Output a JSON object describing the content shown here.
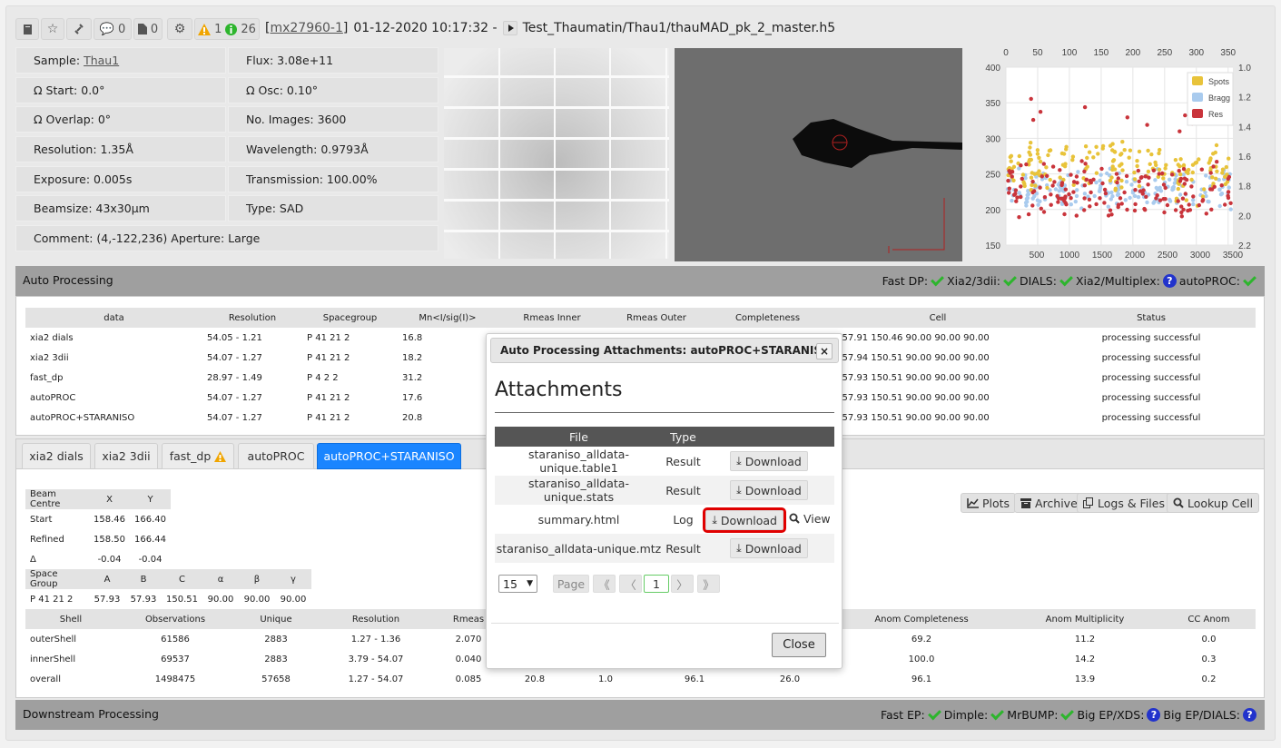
{
  "header": {
    "comments_count": "0",
    "files_count": "0",
    "warning_count": "1",
    "info_count": "26",
    "session_link": "mx27960-1",
    "bracket_open": "[",
    "bracket_close": "]",
    "datetime": "01-12-2020 10:17:32 -",
    "path": "Test_Thaumatin/Thau1/thauMAD_pk_2_master.h5"
  },
  "info": {
    "sample_label": "Sample:",
    "sample_value": "Thau1",
    "flux": "Flux: 3.08e+11",
    "omega_start": "Ω Start: 0.0°",
    "omega_osc": "Ω Osc: 0.10°",
    "omega_overlap": "Ω Overlap: 0°",
    "no_images": "No. Images: 3600",
    "resolution": "Resolution: 1.35Å",
    "wavelength": "Wavelength: 0.9793Å",
    "exposure": "Exposure: 0.005s",
    "transmission": "Transmission: 100.00%",
    "beamsize": "Beamsize: 43x30µm",
    "type": "Type: SAD",
    "comment": "Comment: (4,-122,236) Aperture: Large"
  },
  "plot": {
    "top_ticks": [
      "0",
      "50",
      "100",
      "150",
      "200",
      "250",
      "300",
      "350"
    ],
    "left_ticks": [
      "400",
      "350",
      "300",
      "250",
      "200",
      "150"
    ],
    "right_ticks": [
      "1.0",
      "1.2",
      "1.4",
      "1.6",
      "1.8",
      "2.0",
      "2.2"
    ],
    "bottom_ticks": [
      "500",
      "1000",
      "1500",
      "2000",
      "2500",
      "3000",
      "3500"
    ],
    "legend": [
      "Spots",
      "Bragg",
      "Res"
    ],
    "colors": {
      "spots": "#e8c33a",
      "bragg": "#a9cbee",
      "res": "#c9343b"
    }
  },
  "auto_processing": {
    "title": "Auto Processing",
    "status_labels": [
      "Fast DP:",
      "Xia2/3dii:",
      "DIALS:",
      "Xia2/Multiplex:",
      "autoPROC:"
    ],
    "columns": [
      "data",
      "Resolution",
      "Spacegroup",
      "Mn<I/sig(I)>",
      "Rmeas Inner",
      "Rmeas Outer",
      "Completeness",
      "Cell",
      "Status"
    ],
    "rows": [
      {
        "data": "xia2 dials",
        "res": "54.05 - 1.21",
        "sg": "P 41 21 2",
        "mn": "16.8",
        "cell": "3 57.91 150.46 90.00 90.00 90.00",
        "status": "processing successful"
      },
      {
        "data": "xia2 3dii",
        "res": "54.07 - 1.27",
        "sg": "P 41 21 2",
        "mn": "18.2",
        "cell": "4 57.94 150.51 90.00 90.00 90.00",
        "status": "processing successful"
      },
      {
        "data": "fast_dp",
        "res": "28.97 - 1.49",
        "sg": "P 4 2 2",
        "mn": "31.2",
        "cell": "3 57.93 150.51 90.00 90.00 90.00",
        "status": "processing successful"
      },
      {
        "data": "autoPROC",
        "res": "54.07 - 1.27",
        "sg": "P 41 21 2",
        "mn": "17.6",
        "cell": "3 57.93 150.51 90.00 90.00 90.00",
        "status": "processing successful"
      },
      {
        "data": "autoPROC+STARANISO",
        "res": "54.07 - 1.27",
        "sg": "P 41 21 2",
        "mn": "20.8",
        "cell": "3 57.93 150.51 90.00 90.00 90.00",
        "status": "processing successful"
      }
    ]
  },
  "tabs": [
    "xia2 dials",
    "xia2 3dii",
    "fast_dp",
    "autoPROC",
    "autoPROC+STARANISO"
  ],
  "beam": {
    "headers": [
      "Beam Centre",
      "X",
      "Y"
    ],
    "rows": [
      [
        "Start",
        "158.46",
        "166.40"
      ],
      [
        "Refined",
        "158.50",
        "166.44"
      ],
      [
        "Δ",
        "-0.04",
        "-0.04"
      ]
    ]
  },
  "spacegroup": {
    "headers": [
      "Space Group",
      "A",
      "B",
      "C",
      "α",
      "β",
      "γ"
    ],
    "row": [
      "P 41 21 2",
      "57.93",
      "57.93",
      "150.51",
      "90.00",
      "90.00",
      "90.00"
    ]
  },
  "action_buttons": [
    "Plots",
    "Archive",
    "Logs & Files",
    "Lookup Cell"
  ],
  "shell": {
    "headers": [
      "Shell",
      "Observations",
      "Unique",
      "Resolution",
      "Rmeas",
      "Anom Completeness",
      "Anom Multiplicity",
      "CC Anom"
    ],
    "rows": [
      {
        "shell": "outerShell",
        "obs": "61586",
        "uniq": "2883",
        "res": "1.27 - 1.36",
        "rmeas": "2.070",
        "c5": "",
        "c6": "",
        "c7": "",
        "c8": "",
        "ac": "69.2",
        "am": "11.2",
        "cc": "0.0"
      },
      {
        "shell": "innerShell",
        "obs": "69537",
        "uniq": "2883",
        "res": "3.79 - 54.07",
        "rmeas": "0.040",
        "c5": "",
        "c6": "",
        "c7": "",
        "c8": "",
        "ac": "100.0",
        "am": "14.2",
        "cc": "0.3"
      },
      {
        "shell": "overall",
        "obs": "1498475",
        "uniq": "57658",
        "res": "1.27 - 54.07",
        "rmeas": "0.085",
        "c5": "20.8",
        "c6": "1.0",
        "c7": "96.1",
        "c8": "26.0",
        "ac": "96.1",
        "am": "13.9",
        "cc": "0.2"
      }
    ]
  },
  "downstream": {
    "title": "Downstream Processing",
    "status_labels": [
      "Fast EP:",
      "Dimple:",
      "MrBUMP:",
      "Big EP/XDS:",
      "Big EP/DIALS:"
    ]
  },
  "modal": {
    "title": "Auto Processing Attachments: autoPROC+STARANISO",
    "close_x": "×",
    "heading": "Attachments",
    "columns": [
      "File",
      "Type"
    ],
    "rows": [
      {
        "file": "staraniso_alldata-unique.table1",
        "type": "Result"
      },
      {
        "file": "staraniso_alldata-unique.stats",
        "type": "Result"
      },
      {
        "file": "summary.html",
        "type": "Log"
      },
      {
        "file": "staraniso_alldata-unique.mtz",
        "type": "Result"
      }
    ],
    "download_label": "Download",
    "view_label": "View",
    "page_size": "15",
    "page_label": "Page",
    "current_page": "1",
    "close_label": "Close"
  }
}
